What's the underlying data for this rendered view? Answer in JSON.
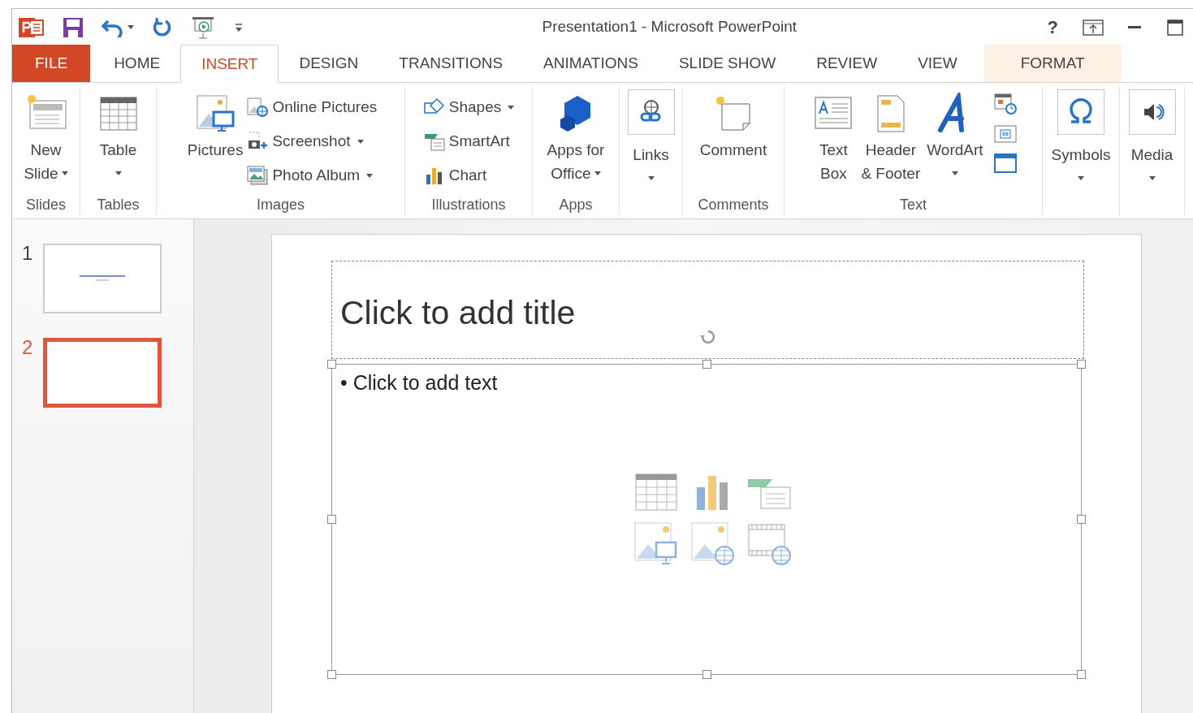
{
  "window": {
    "title": "Presentation1 - Microsoft PowerPoint",
    "help": "?"
  },
  "tabs": [
    {
      "label": "FILE",
      "kind": "file",
      "selected": false
    },
    {
      "label": "HOME",
      "kind": "plain",
      "selected": false
    },
    {
      "label": "INSERT",
      "kind": "plain",
      "selected": true
    },
    {
      "label": "DESIGN",
      "kind": "plain",
      "selected": false
    },
    {
      "label": "TRANSITIONS",
      "kind": "plain",
      "selected": false
    },
    {
      "label": "ANIMATIONS",
      "kind": "plain",
      "selected": false
    },
    {
      "label": "SLIDE SHOW",
      "kind": "plain",
      "selected": false
    },
    {
      "label": "REVIEW",
      "kind": "plain",
      "selected": false
    },
    {
      "label": "VIEW",
      "kind": "plain",
      "selected": false
    },
    {
      "label": "FORMAT",
      "kind": "contextual",
      "selected": false
    }
  ],
  "ribbon": {
    "groups": [
      {
        "label": "Slides",
        "items": [
          {
            "kind": "large",
            "lines": [
              "New",
              "Slide"
            ],
            "dropdown": true
          }
        ]
      },
      {
        "label": "Tables",
        "items": [
          {
            "kind": "large",
            "lines": [
              "Table"
            ],
            "dropdown": true
          }
        ]
      },
      {
        "label": "Images",
        "items": [
          {
            "kind": "large",
            "lines": [
              "Pictures"
            ],
            "dropdown": false
          },
          {
            "kind": "stack",
            "entries": [
              {
                "label": "Online Pictures",
                "dropdown": false
              },
              {
                "label": "Screenshot",
                "dropdown": true
              },
              {
                "label": "Photo Album",
                "dropdown": true
              }
            ]
          }
        ]
      },
      {
        "label": "Illustrations",
        "items": [
          {
            "kind": "stack",
            "entries": [
              {
                "label": "Shapes",
                "dropdown": true
              },
              {
                "label": "SmartArt",
                "dropdown": false
              },
              {
                "label": "Chart",
                "dropdown": false
              }
            ]
          }
        ]
      },
      {
        "label": "Apps",
        "items": [
          {
            "kind": "large",
            "lines": [
              "Apps for",
              "Office"
            ],
            "dropdown": true
          }
        ]
      },
      {
        "items": [
          {
            "kind": "boxed",
            "lines": [
              "Links"
            ],
            "dropdown": true
          }
        ]
      },
      {
        "label": "Comments",
        "items": [
          {
            "kind": "large",
            "lines": [
              "Comment"
            ],
            "dropdown": false
          }
        ]
      },
      {
        "label": "Text",
        "items": [
          {
            "kind": "large",
            "lines": [
              "Text",
              "Box"
            ],
            "dropdown": false
          },
          {
            "kind": "large",
            "lines": [
              "Header",
              "& Footer"
            ],
            "dropdown": false
          },
          {
            "kind": "large",
            "lines": [
              "WordArt"
            ],
            "dropdown": true
          },
          {
            "kind": "icons"
          }
        ]
      },
      {
        "items": [
          {
            "kind": "boxed",
            "lines": [
              "Symbols"
            ],
            "dropdown": true
          }
        ]
      },
      {
        "items": [
          {
            "kind": "boxed",
            "lines": [
              "Media"
            ],
            "dropdown": true
          }
        ]
      }
    ]
  },
  "slides": [
    {
      "number": "1",
      "selected": false,
      "has_content": true
    },
    {
      "number": "2",
      "selected": true,
      "has_content": false
    }
  ],
  "slide": {
    "title_placeholder": "Click to add title",
    "body_placeholder": "• Click to add text"
  }
}
